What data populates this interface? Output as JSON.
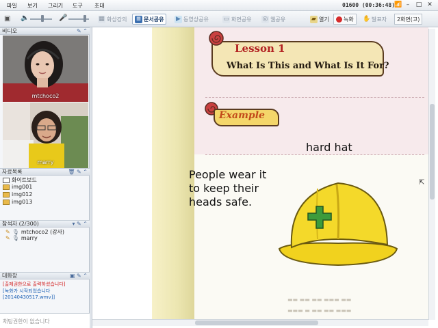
{
  "menu": [
    "파일",
    "보기",
    "그리기",
    "도구",
    "초대"
  ],
  "timer": "01600 (00:36:48)",
  "toolbar": {
    "items": [
      {
        "label": "화상강의",
        "active": false
      },
      {
        "label": "문서공유",
        "active": true
      },
      {
        "label": "동영상공유",
        "active": false
      },
      {
        "label": "화면공유",
        "active": false
      },
      {
        "label": "웹공유",
        "active": false
      },
      {
        "label": "열기",
        "active": false
      },
      {
        "label": "녹화",
        "active": false
      },
      {
        "label": "발표자",
        "active": false
      },
      {
        "label": "2화면(고)",
        "active": false
      }
    ]
  },
  "video": {
    "title": "비디오",
    "participants": [
      "mtchoco2",
      "marry"
    ]
  },
  "materials": {
    "title": "자료목록",
    "items": [
      "화이트보드",
      "img001",
      "img012",
      "img013"
    ]
  },
  "attendees": {
    "title": "참석자 (2/300)",
    "items": [
      "mtchoco2 (강사)",
      "marry"
    ]
  },
  "chat": {
    "title": "대화창",
    "lines": [
      {
        "text": "[출제권한으로 출력하셨습니다]",
        "color": "#d11a1a"
      },
      {
        "text": "[녹화가 시작되었습니다",
        "color": "#1a5fb4"
      },
      {
        "text": "[20140430517.wmv]]",
        "color": "#1a5fb4"
      }
    ],
    "input_placeholder": "채팅권한이 없습니다"
  },
  "document": {
    "lesson_title": "Lesson 1",
    "lesson_subtitle": "What Is This and What Is It For?",
    "example_label": "Example",
    "hard_hat_label": "hard hat",
    "people_text_1": "People wear it",
    "people_text_2": "to keep their",
    "people_text_3": "heads safe."
  }
}
